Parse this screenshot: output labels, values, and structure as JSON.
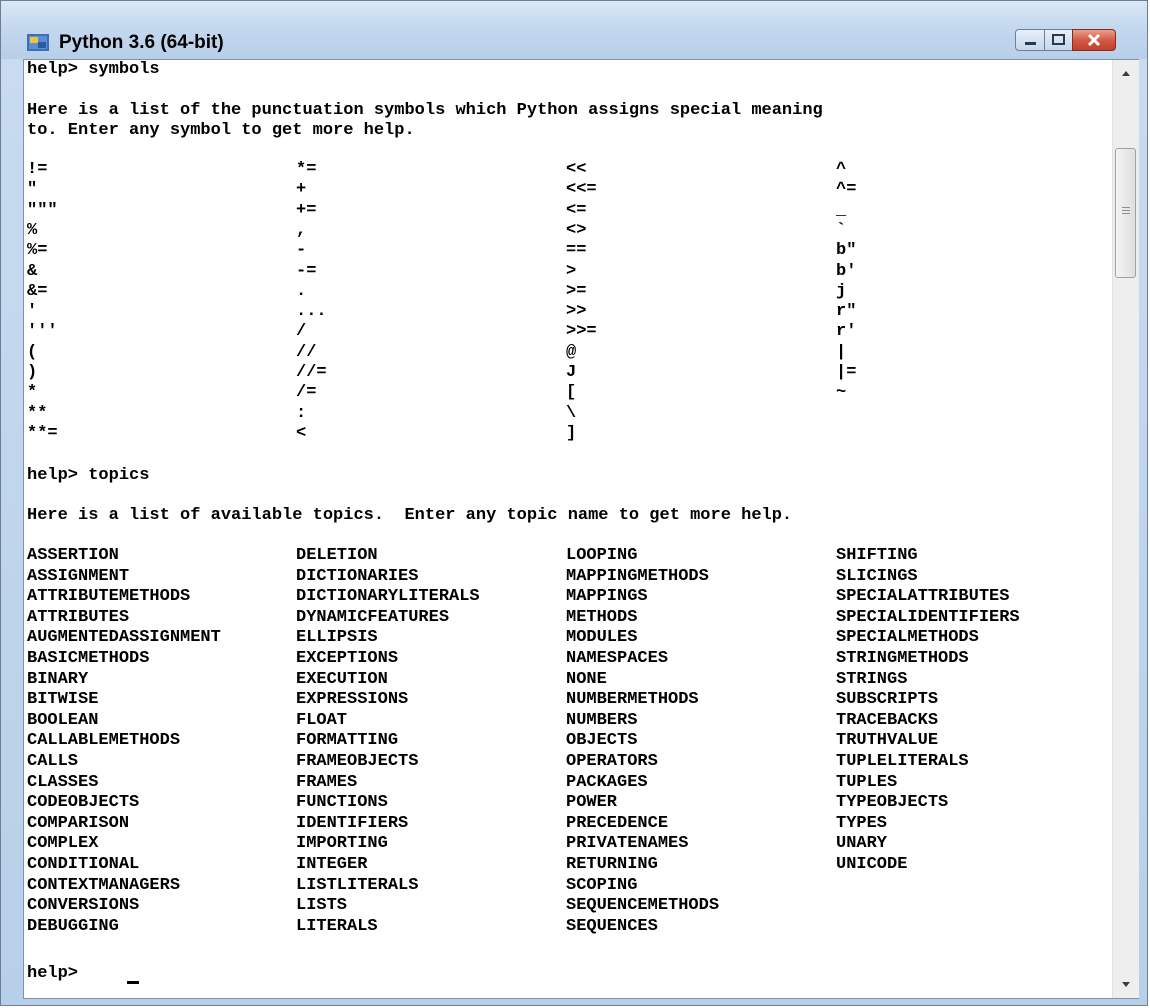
{
  "window": {
    "title": "Python 3.6 (64-bit)",
    "controls": [
      "minimize-button",
      "maximize-button",
      "close-button"
    ]
  },
  "console": {
    "prompt_symbols": "help> symbols",
    "symbols_intro_1": "Here is a list of the punctuation symbols which Python assigns special meaning",
    "symbols_intro_2": "to. Enter any symbol to get more help.",
    "symbols_columns": [
      [
        "!=",
        "\"",
        "\"\"\"",
        "%",
        "%=",
        "&",
        "&=",
        "'",
        "'''",
        "(",
        ")",
        "*",
        "**",
        "**="
      ],
      [
        "*=",
        "+",
        "+=",
        ",",
        "-",
        "-=",
        ".",
        "...",
        "/",
        "//",
        "//=",
        "/=",
        ":",
        "<"
      ],
      [
        "<<",
        "<<=",
        "<=",
        "<>",
        "==",
        ">",
        ">=",
        ">>",
        ">>=",
        "@",
        "J",
        "[",
        "\\",
        "]"
      ],
      [
        "^",
        "^=",
        "_",
        "`",
        "b\"",
        "b'",
        "j",
        "r\"",
        "r'",
        "|",
        "|=",
        "~"
      ]
    ],
    "prompt_topics": "help> topics",
    "topics_intro": "Here is a list of available topics.  Enter any topic name to get more help.",
    "topics_columns": [
      [
        "ASSERTION",
        "ASSIGNMENT",
        "ATTRIBUTEMETHODS",
        "ATTRIBUTES",
        "AUGMENTEDASSIGNMENT",
        "BASICMETHODS",
        "BINARY",
        "BITWISE",
        "BOOLEAN",
        "CALLABLEMETHODS",
        "CALLS",
        "CLASSES",
        "CODEOBJECTS",
        "COMPARISON",
        "COMPLEX",
        "CONDITIONAL",
        "CONTEXTMANAGERS",
        "CONVERSIONS",
        "DEBUGGING"
      ],
      [
        "DELETION",
        "DICTIONARIES",
        "DICTIONARYLITERALS",
        "DYNAMICFEATURES",
        "ELLIPSIS",
        "EXCEPTIONS",
        "EXECUTION",
        "EXPRESSIONS",
        "FLOAT",
        "FORMATTING",
        "FRAMEOBJECTS",
        "FRAMES",
        "FUNCTIONS",
        "IDENTIFIERS",
        "IMPORTING",
        "INTEGER",
        "LISTLITERALS",
        "LISTS",
        "LITERALS"
      ],
      [
        "LOOPING",
        "MAPPINGMETHODS",
        "MAPPINGS",
        "METHODS",
        "MODULES",
        "NAMESPACES",
        "NONE",
        "NUMBERMETHODS",
        "NUMBERS",
        "OBJECTS",
        "OPERATORS",
        "PACKAGES",
        "POWER",
        "PRECEDENCE",
        "PRIVATENAMES",
        "RETURNING",
        "SCOPING",
        "SEQUENCEMETHODS",
        "SEQUENCES"
      ],
      [
        "SHIFTING",
        "SLICINGS",
        "SPECIALATTRIBUTES",
        "SPECIALIDENTIFIERS",
        "SPECIALMETHODS",
        "STRINGMETHODS",
        "STRINGS",
        "SUBSCRIPTS",
        "TRACEBACKS",
        "TRUTHVALUE",
        "TUPLELITERALS",
        "TUPLES",
        "TYPEOBJECTS",
        "TYPES",
        "UNARY",
        "UNICODE"
      ]
    ],
    "prompt_current": "help> "
  }
}
